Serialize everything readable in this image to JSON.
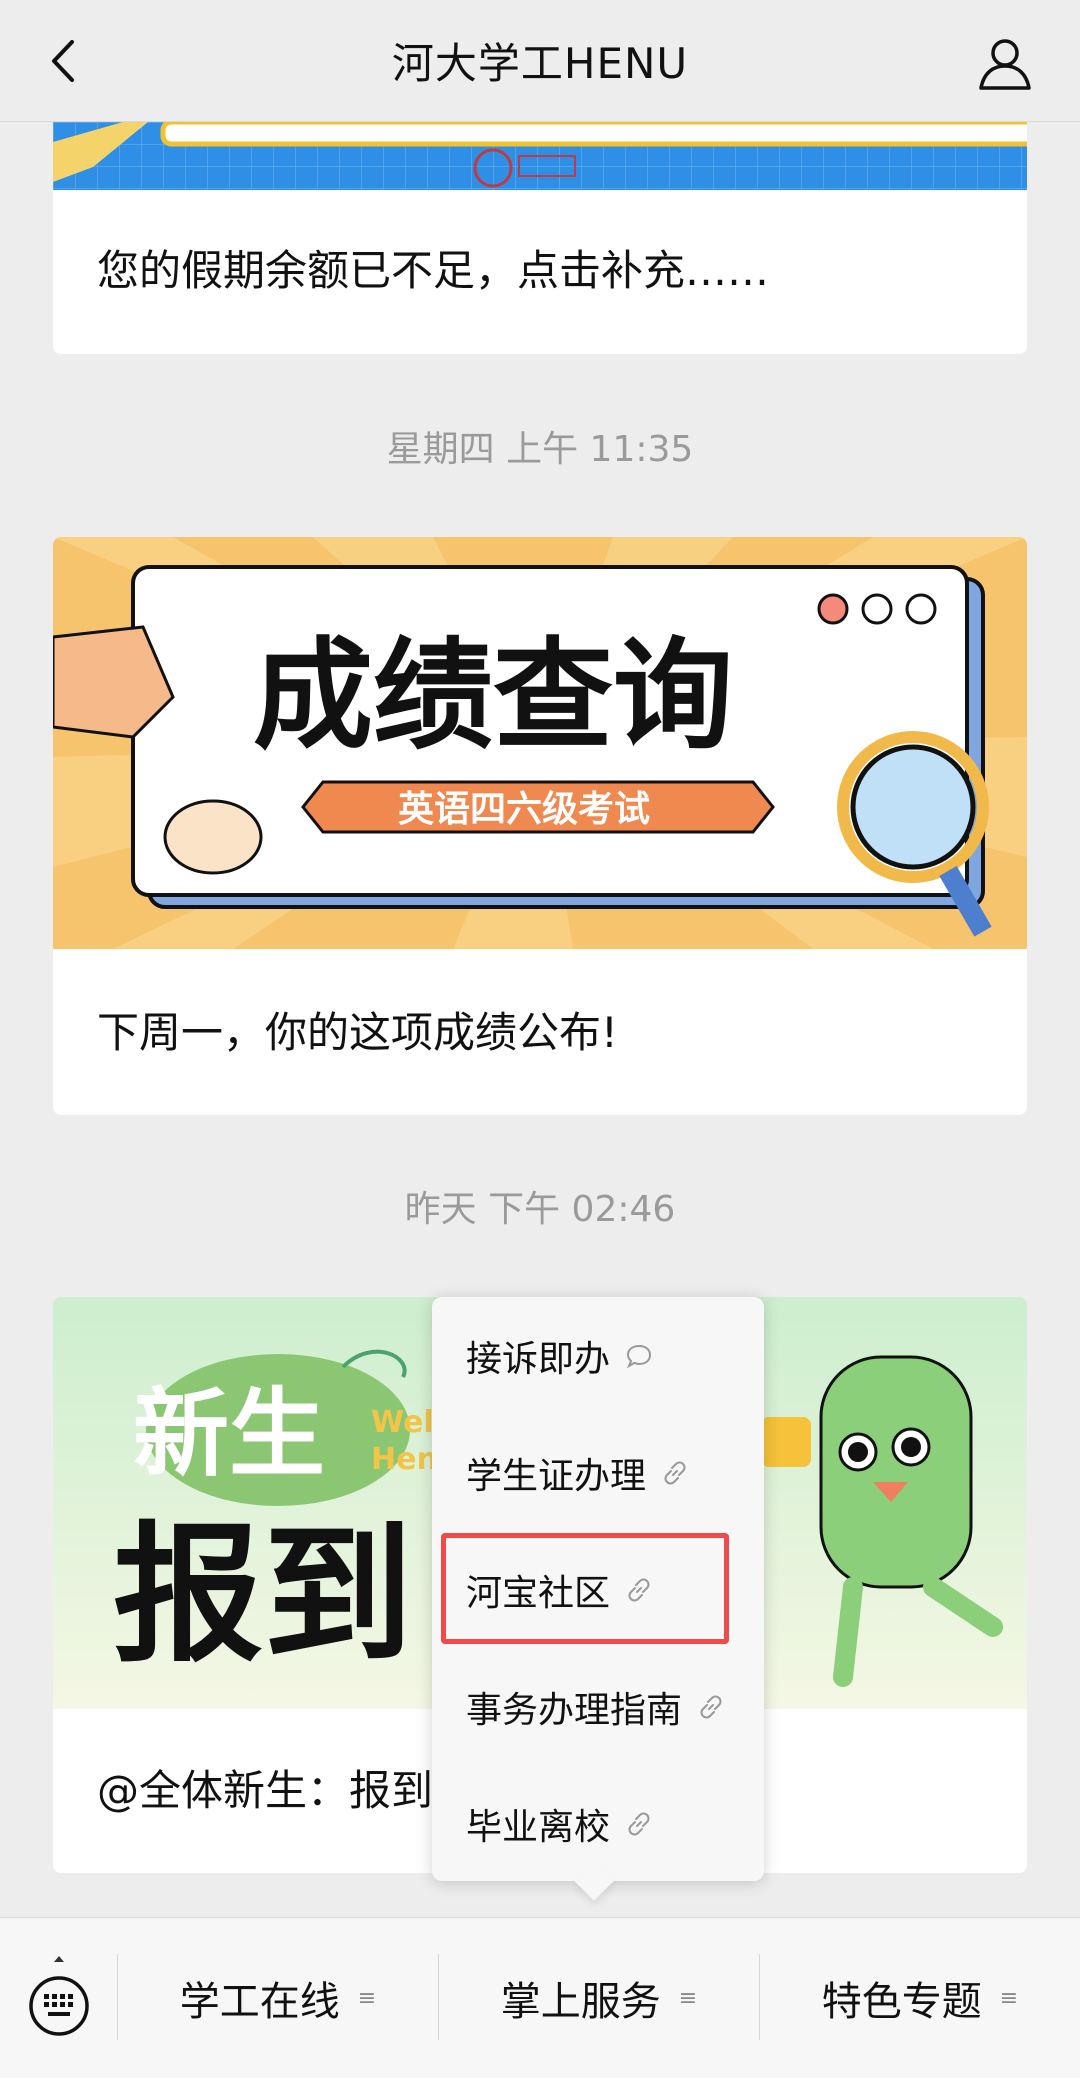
{
  "header": {
    "title": "河大学工HENU"
  },
  "messages": [
    {
      "caption": "您的假期余额已不足，点击补充……"
    },
    {
      "time": "星期四 上午 11:35",
      "caption": "下周一，你的这项成绩公布!",
      "banner_title": "成绩查询",
      "banner_subtitle": "英语四六级考试"
    },
    {
      "time": "昨天 下午 02:46",
      "caption": "@全体新生：报到",
      "banner_title_1": "新生",
      "banner_title_2": "报到",
      "banner_en": "Wel\nHen"
    }
  ],
  "popup_menu": {
    "items": [
      {
        "label": "接诉即办",
        "icon": "chat-bubble-icon"
      },
      {
        "label": "学生证办理",
        "icon": "link-icon"
      },
      {
        "label": "河宝社区",
        "icon": "link-icon",
        "highlighted": true
      },
      {
        "label": "事务办理指南",
        "icon": "link-icon"
      },
      {
        "label": "毕业离校",
        "icon": "link-icon"
      }
    ]
  },
  "bottom_tabs": [
    {
      "label": "学工在线"
    },
    {
      "label": "掌上服务"
    },
    {
      "label": "特色专题"
    }
  ],
  "colors": {
    "highlight": "#ef4b4b",
    "background": "#ededed"
  }
}
